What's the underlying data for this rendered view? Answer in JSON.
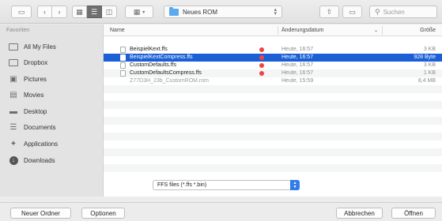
{
  "toolbar": {
    "location": "Neues ROM",
    "search_placeholder": "Suchen"
  },
  "sidebar": {
    "heading": "Favoriten",
    "items": [
      {
        "label": "All My Files",
        "icon": "all-files-icon"
      },
      {
        "label": "Dropbox",
        "icon": "dropbox-icon"
      },
      {
        "label": "Pictures",
        "icon": "pictures-icon"
      },
      {
        "label": "Movies",
        "icon": "movies-icon"
      },
      {
        "label": "Desktop",
        "icon": "desktop-icon"
      },
      {
        "label": "Documents",
        "icon": "documents-icon"
      },
      {
        "label": "Applications",
        "icon": "applications-icon"
      },
      {
        "label": "Downloads",
        "icon": "downloads-icon"
      }
    ]
  },
  "list": {
    "columns": {
      "name": "Name",
      "date": "Änderungsdatum",
      "size": "Größe"
    },
    "rows": [
      {
        "name": "BeispielKext.ffs",
        "date": "Heute, 16:57",
        "size": "3 KB",
        "tag": "red"
      },
      {
        "name": "BeispielKextCompress.ffs",
        "date": "Heute, 16:57",
        "size": "928 Byte",
        "tag": "red"
      },
      {
        "name": "CustomDefaults.ffs",
        "date": "Heute, 16:57",
        "size": "3 KB",
        "tag": "red"
      },
      {
        "name": "CustomDefaultsCompress.ffs",
        "date": "Heute, 16:57",
        "size": "1 KB",
        "tag": "red"
      },
      {
        "name": "Z77D3H_23b_CustomROM.rom",
        "date": "Heute, 15:59",
        "size": "8,4 MB",
        "tag": ""
      }
    ]
  },
  "filter": {
    "value": "FFS files (*.ffs *.bin)"
  },
  "buttons": {
    "new_folder": "Neuer Ordner",
    "options": "Optionen",
    "cancel": "Abbrechen",
    "open": "Öffnen"
  },
  "colors": {
    "selection": "#1b5fd6",
    "tag_red": "#f0443f",
    "accent": "#2f7de8"
  }
}
